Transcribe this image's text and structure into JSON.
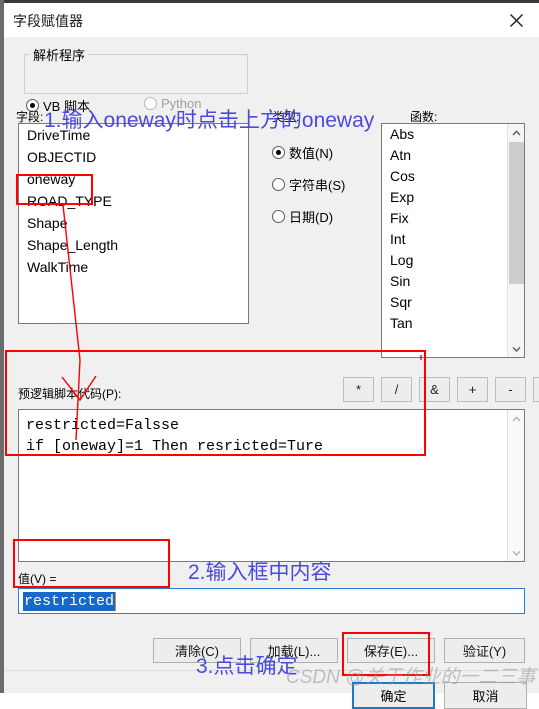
{
  "window": {
    "title": "字段赋值器",
    "close_icon": "close-icon"
  },
  "parser": {
    "legend": "解析程序",
    "options": [
      {
        "label": "VB 脚本",
        "selected": true,
        "enabled": true
      },
      {
        "label": "Python",
        "selected": false,
        "enabled": false
      }
    ]
  },
  "fields": {
    "label": "字段:",
    "items": [
      "DriveTime",
      "OBJECTID",
      "oneway",
      "ROAD_TYPE",
      "Shape",
      "Shape_Length",
      "WalkTime"
    ]
  },
  "type": {
    "label": "类型:",
    "options": [
      {
        "label": "数值(N)",
        "selected": true
      },
      {
        "label": "字符串(S)",
        "selected": false
      },
      {
        "label": "日期(D)",
        "selected": false
      }
    ]
  },
  "functions": {
    "label": "函数:",
    "items": [
      "Abs",
      "Atn",
      "Cos",
      "Exp",
      "Fix",
      "Int",
      "Log",
      "Sin",
      "Sqr",
      "Tan"
    ],
    "scroll_up_icon": "chevron-up-icon",
    "scroll_down_icon": "chevron-down-icon"
  },
  "code": {
    "label": "预逻辑脚本代码(P):",
    "operators": [
      "*",
      "/",
      "&",
      "+",
      "-",
      "="
    ],
    "text": "restricted=Falsse\nif [oneway]=1 Then resricted=Ture",
    "scroll_up_icon": "chevron-up-icon",
    "scroll_down_icon": "chevron-down-icon"
  },
  "value": {
    "label": "值(V) =",
    "text": "restricted",
    "selected": true
  },
  "actions": {
    "clear": "清除(C)",
    "load": "加载(L)...",
    "save": "保存(E)...",
    "validate": "验证(Y)"
  },
  "footer": {
    "ok": "确定",
    "cancel": "取消"
  },
  "annotations": {
    "color_red": "#FE0000",
    "color_blue": "#4A4AE0",
    "step1": "1.输入oneway时点击上方的oneway",
    "step2": "2.输入框中内容",
    "step3": "3.点击确定"
  },
  "watermark": "CSDN @关于作业的一二三事"
}
